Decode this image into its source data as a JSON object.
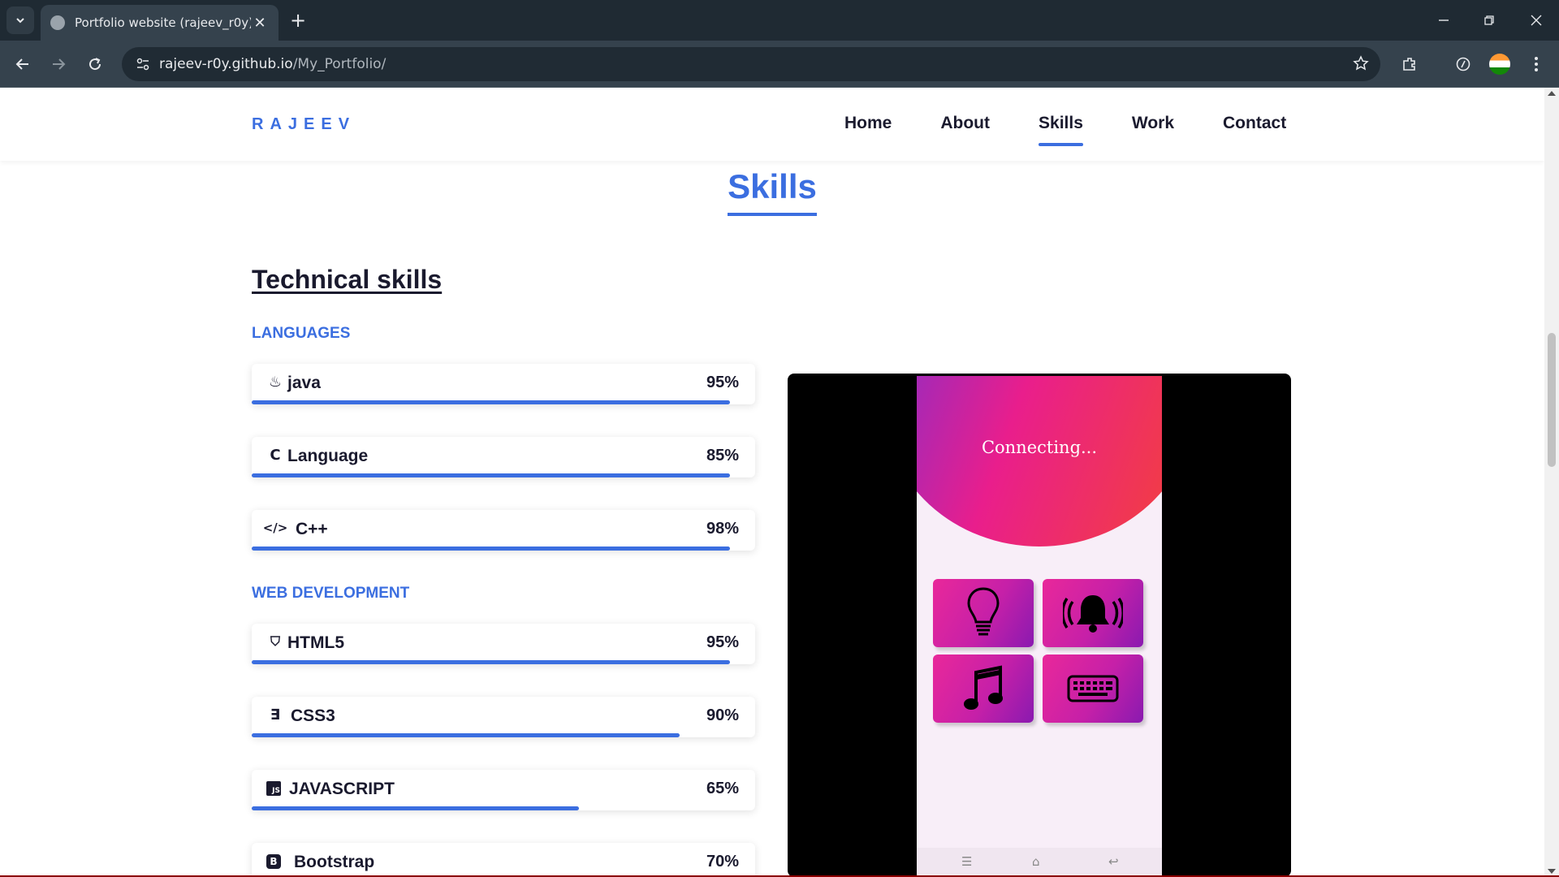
{
  "browser": {
    "tab_title": "Portfolio website (rajeev_r0y)",
    "tab_close": "✕",
    "new_tab": "+",
    "url_host": "rajeev-r0y.github.io",
    "url_path": "/My_Portfolio/"
  },
  "site": {
    "logo": "RAJEEV",
    "nav": [
      {
        "label": "Home"
      },
      {
        "label": "About"
      },
      {
        "label": "Skills",
        "active": true
      },
      {
        "label": "Work"
      },
      {
        "label": "Contact"
      }
    ],
    "section_title": "Skills",
    "tech_heading": "Technical skills",
    "groups": {
      "languages": "LANGUAGES",
      "web": "WEB DEVELOPMENT"
    },
    "skills": [
      {
        "icon": "java-icon",
        "glyph": "♨",
        "name": "java",
        "percent": "95%",
        "level": 95
      },
      {
        "icon": "c-icon",
        "glyph": "C",
        "name": "Language",
        "percent": "85%",
        "level": 95
      },
      {
        "icon": "code-icon",
        "glyph": "</>",
        "name": "C++",
        "percent": "98%",
        "level": 95
      },
      {
        "icon": "html5-icon",
        "glyph": "⛉",
        "name": "HTML5",
        "percent": "95%",
        "level": 95
      },
      {
        "icon": "css3-icon",
        "glyph": "∃",
        "name": "CSS3",
        "percent": "90%",
        "level": 85
      },
      {
        "icon": "javascript-icon",
        "glyph": "JS",
        "name": "JAVASCRIPT",
        "percent": "65%",
        "level": 65
      },
      {
        "icon": "bootstrap-icon",
        "glyph": "B",
        "name": "Bootstrap",
        "percent": "70%",
        "level": 70
      }
    ],
    "video": {
      "status": "Connecting...",
      "tiles": [
        "lightbulb-icon",
        "bell-ringing-icon",
        "music-note-icon",
        "keyboard-icon"
      ]
    }
  },
  "colors": {
    "accent": "#3b6ee0",
    "text": "#1a1a2e"
  }
}
